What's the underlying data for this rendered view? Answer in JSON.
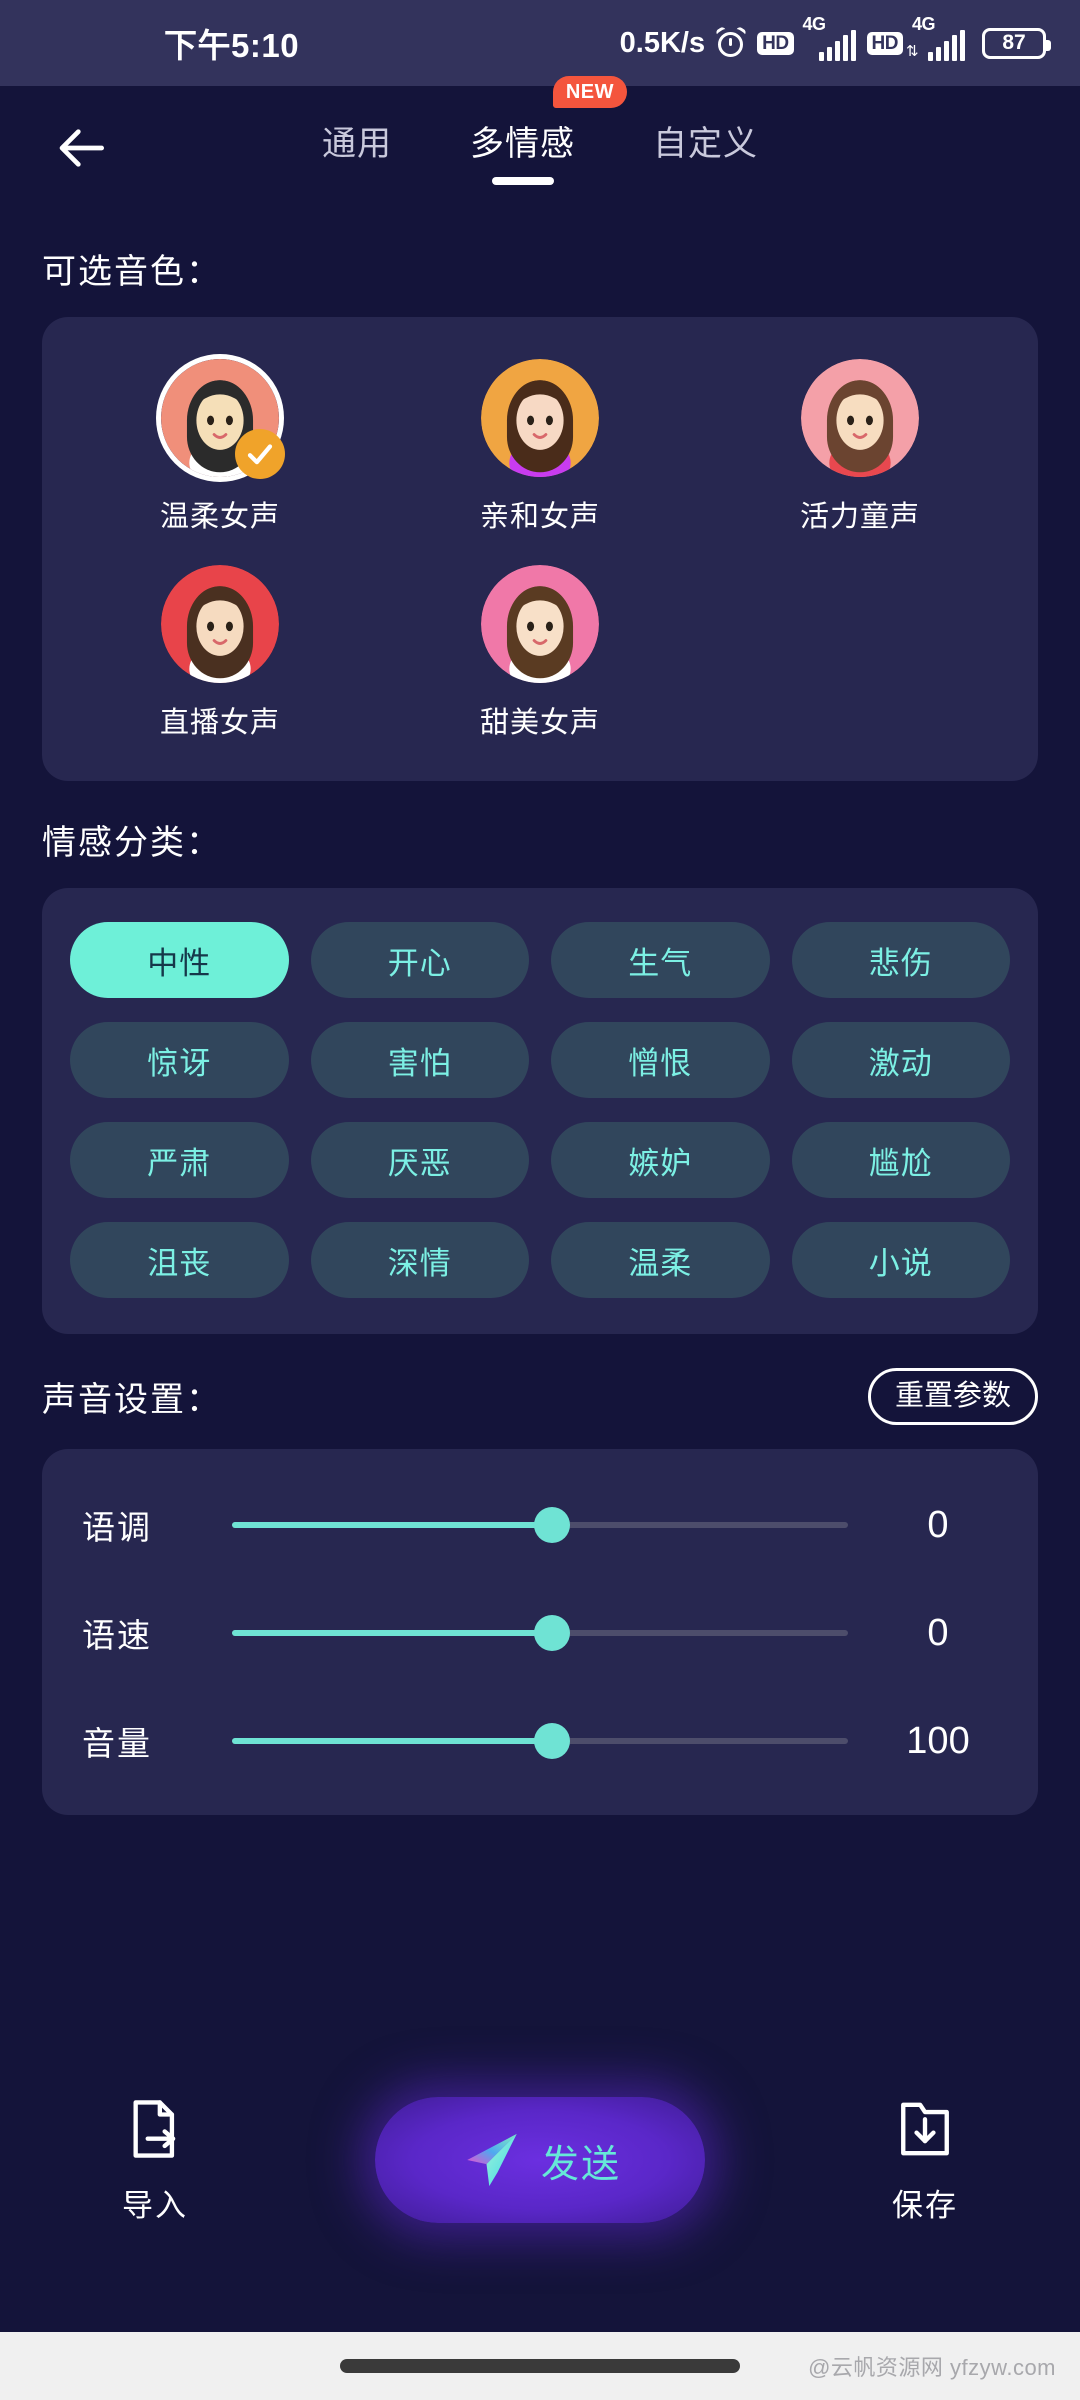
{
  "status_bar": {
    "time": "下午5:10",
    "net_speed": "0.5K/s",
    "alarm_icon": "alarm-clock-icon",
    "hd1": "HD",
    "net1": "4G",
    "hd2": "HD",
    "net2": "4G",
    "battery": "87"
  },
  "tabbar": {
    "back_icon": "back-arrow-icon",
    "tabs": [
      {
        "label": "通用",
        "active": false,
        "badge": null
      },
      {
        "label": "多情感",
        "active": true,
        "badge": "NEW"
      },
      {
        "label": "自定义",
        "active": false,
        "badge": null
      }
    ]
  },
  "voice_section": {
    "title": "可选音色：",
    "voices": [
      {
        "label": "温柔女声",
        "selected": true,
        "ring": "#f08f7a",
        "hair": "#2b2b2b",
        "skin": "#f5dfb8",
        "shirt": "#ffffff"
      },
      {
        "label": "亲和女声",
        "selected": false,
        "ring": "#f0a542",
        "hair": "#4a2c1a",
        "skin": "#f7d9c4",
        "shirt": "#c83cf0"
      },
      {
        "label": "活力童声",
        "selected": false,
        "ring": "#f4a0a8",
        "hair": "#6b4430",
        "skin": "#f7ddc0",
        "shirt": "#e8484f"
      },
      {
        "label": "直播女声",
        "selected": false,
        "ring": "#e8444a",
        "hair": "#4a3020",
        "skin": "#f6dbc0",
        "shirt": "#ffffff"
      },
      {
        "label": "甜美女声",
        "selected": false,
        "ring": "#f078a8",
        "hair": "#5a3b22",
        "skin": "#f8e0c8",
        "shirt": "#ffffff"
      }
    ],
    "check_icon": "check-icon"
  },
  "emotion_section": {
    "title": "情感分类：",
    "chips": [
      {
        "label": "中性",
        "active": true
      },
      {
        "label": "开心",
        "active": false
      },
      {
        "label": "生气",
        "active": false
      },
      {
        "label": "悲伤",
        "active": false
      },
      {
        "label": "惊讶",
        "active": false
      },
      {
        "label": "害怕",
        "active": false
      },
      {
        "label": "憎恨",
        "active": false
      },
      {
        "label": "激动",
        "active": false
      },
      {
        "label": "严肃",
        "active": false
      },
      {
        "label": "厌恶",
        "active": false
      },
      {
        "label": "嫉妒",
        "active": false
      },
      {
        "label": "尴尬",
        "active": false
      },
      {
        "label": "沮丧",
        "active": false
      },
      {
        "label": "深情",
        "active": false
      },
      {
        "label": "温柔",
        "active": false
      },
      {
        "label": "小说",
        "active": false
      }
    ]
  },
  "sound_section": {
    "title": "声音设置：",
    "reset_label": "重置参数",
    "sliders": [
      {
        "label": "语调",
        "value": "0",
        "percent": 52
      },
      {
        "label": "语速",
        "value": "0",
        "percent": 52
      },
      {
        "label": "音量",
        "value": "100",
        "percent": 52
      }
    ]
  },
  "actions": {
    "import_label": "导入",
    "import_icon": "file-export-icon",
    "send_label": "发送",
    "send_icon": "paper-plane-icon",
    "save_label": "保存",
    "save_icon": "folder-download-icon"
  },
  "footer": {
    "watermark": "@云帆资源网 yfzyw.com"
  },
  "colors": {
    "page_bg": "#14143a",
    "panel_bg": "#272750",
    "statusbar_bg": "#33335c",
    "accent_cyan": "#6ef0d8",
    "chip_bg": "#31465c",
    "chip_text": "#7cf0e4",
    "badge_red": "#f4553d",
    "check_orange": "#f0a32a",
    "send_purple": "#5a27c8"
  }
}
